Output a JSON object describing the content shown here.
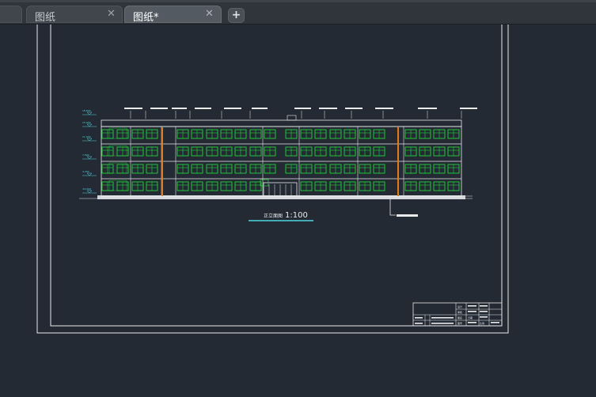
{
  "tabs": [
    {
      "label": "图纸",
      "close": "✕"
    },
    {
      "label": "图纸*",
      "close": "✕"
    }
  ],
  "add_tab": "+",
  "drawing": {
    "elevation_caption": "正立面图",
    "scale": "1:100",
    "level_marks": [
      "18.600",
      "15.000",
      "11.400",
      "7.800",
      "4.200",
      "±0.000"
    ],
    "title_block": {
      "cells": [
        "设计",
        "审核",
        "图名",
        "图号",
        "日期",
        "比例"
      ]
    },
    "colors": {
      "window": "#22d43a",
      "frame": "#e8eaec",
      "accent": "#e07a1a",
      "dimension": "#4fd6e0"
    }
  }
}
